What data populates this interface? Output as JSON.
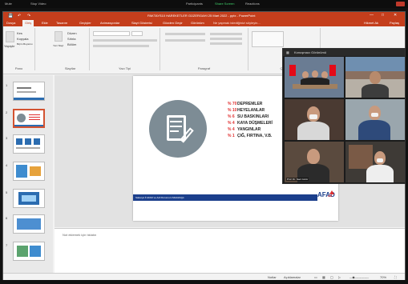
{
  "zoom": {
    "top_items": [
      "Mute",
      "Stop Video",
      "Participants",
      "Share Screen",
      "Reactions"
    ]
  },
  "ppt": {
    "title": "PAKTAYS10 HAREKETLER GÜZERGAHI 25 Mart 2022 - pptx - PowerPoint",
    "window_controls": [
      "—",
      "□",
      "✕"
    ],
    "tabs": [
      "Dosya",
      "Giriş",
      "Ekle",
      "Tasarım",
      "Geçişler",
      "Animasyonlar",
      "Slayt Gösterisi",
      "Gözden Geçir",
      "Görünüm"
    ],
    "active_tab_index": 1,
    "search_placeholder": "Ne yapmak istediğinizi söyleyin...",
    "right_items": [
      "Hikmet Ak",
      "Paylaş"
    ],
    "ribbon_groups": [
      "Pano",
      "Slaytlar",
      "Yazı Tipi",
      "Paragraf",
      "Çizim",
      "Düzenleme"
    ],
    "ribbon_items": {
      "paste": "Yapıştır",
      "cut": "Kes",
      "copy": "Kopyala",
      "format_painter": "Biçim Boyacısı",
      "new_slide": "Yeni Slayt",
      "layout": "Düzen",
      "reset": "Sıfırla",
      "section": "Bölüm"
    },
    "thumbnail_numbers": [
      "1",
      "2",
      "3",
      "4",
      "5",
      "6",
      "7"
    ],
    "selected_thumbnail": 2,
    "notes_placeholder": "Not eklemek için tıklatın",
    "status": {
      "notes": "Notlar",
      "comments": "Açıklamalar",
      "zoom_percent": "70%"
    }
  },
  "slide": {
    "stats": [
      {
        "pct": "% 70",
        "label": "DEPREMLER"
      },
      {
        "pct": "% 10",
        "label": "HEYELANLAR"
      },
      {
        "pct": "% 6",
        "label": "SU BASKINLARI"
      },
      {
        "pct": "% 4",
        "label": "KAYA DÜŞMELERİ"
      },
      {
        "pct": "% 4",
        "label": "YANGINLAR"
      },
      {
        "pct": "% 1",
        "label": "ÇIĞ, FIRTINA, V.B."
      }
    ],
    "footer": "Sakarya İl AFAD ve Acil Durumum Müdürlüğü",
    "logo": "AFAD",
    "logo_sub": "İZM"
  },
  "video": {
    "topbar": "Konuşmacı Görünümü",
    "tiles": [
      {
        "name": "",
        "bg": "#6a7c93"
      },
      {
        "name": "",
        "bg": "#8a7060"
      },
      {
        "name": "",
        "bg": "#4a3a32"
      },
      {
        "name": "",
        "bg": "#9aa6ad"
      },
      {
        "name": "Prof. Dr. Naci Görür",
        "bg": "#5a4a3e"
      },
      {
        "name": "",
        "bg": "#3e3a36"
      }
    ]
  },
  "colors": {
    "ppt_accent": "#c43e1c",
    "stat_red": "#e03030",
    "afad_blue": "#1b3f8c",
    "zoom_green": "#3fcf6a"
  }
}
